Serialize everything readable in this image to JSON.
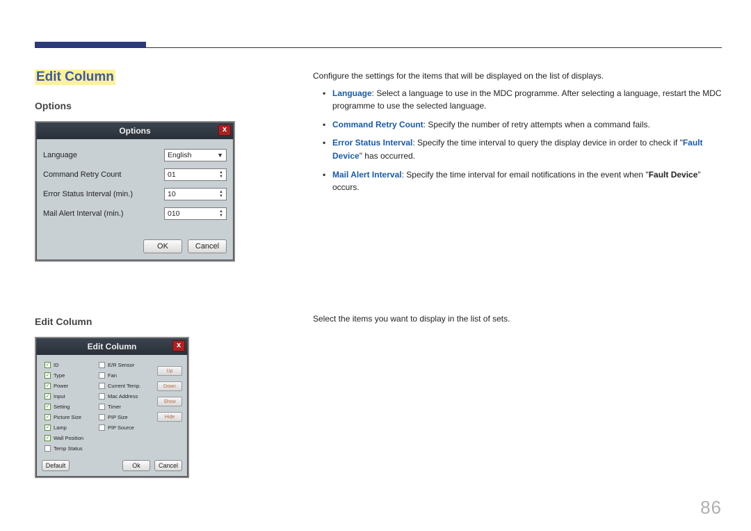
{
  "page": {
    "title": "Edit Column",
    "number": "86"
  },
  "sections": {
    "options_heading": "Options",
    "editcol_heading": "Edit Column"
  },
  "options_dialog": {
    "title": "Options",
    "close": "x",
    "rows": {
      "language_label": "Language",
      "language_value": "English",
      "retry_label": "Command Retry Count",
      "retry_value": "01",
      "error_label": "Error Status Interval (min.)",
      "error_value": "10",
      "mail_label": "Mail Alert Interval (min.)",
      "mail_value": "010"
    },
    "ok": "OK",
    "cancel": "Cancel"
  },
  "editcol_dialog": {
    "title": "Edit Column",
    "close": "x",
    "col1": [
      "ID",
      "Type",
      "Power",
      "Input",
      "Setting",
      "Picture Size",
      "Lamp",
      "Wall Position",
      "Temp Status"
    ],
    "col1_checked": [
      true,
      true,
      true,
      true,
      true,
      true,
      true,
      true,
      false
    ],
    "col2": [
      "E/R Sensor",
      "Fan",
      "Current Temp.",
      "Mac Address",
      "Timer",
      "PIP Size",
      "PIP Source"
    ],
    "btns": [
      "Up",
      "Down",
      "Show",
      "Hide"
    ],
    "default": "Default",
    "ok": "Ok",
    "cancel": "Cancel"
  },
  "right": {
    "intro": "Configure the settings for the items that will be displayed on the list of displays.",
    "items": {
      "lang_b": "Language",
      "lang_t": ": Select a language to use in the MDC programme. After selecting a language, restart the MDC programme to use the selected language.",
      "retry_b": "Command Retry Count",
      "retry_t": ": Specify the number of retry attempts when a command fails.",
      "err_b": "Error Status Interval",
      "err_t1": ": Specify the time interval to query the display device in order to check if \"",
      "err_fd": "Fault Device",
      "err_t2": "\" has occurred.",
      "mail_b": "Mail Alert Interval",
      "mail_t1": ": Specify the time interval for email notifications in the event when \"",
      "mail_fd": "Fault Device",
      "mail_t2": "\" occurs."
    },
    "editcol_text": "Select the items you want to display in the list of sets."
  }
}
